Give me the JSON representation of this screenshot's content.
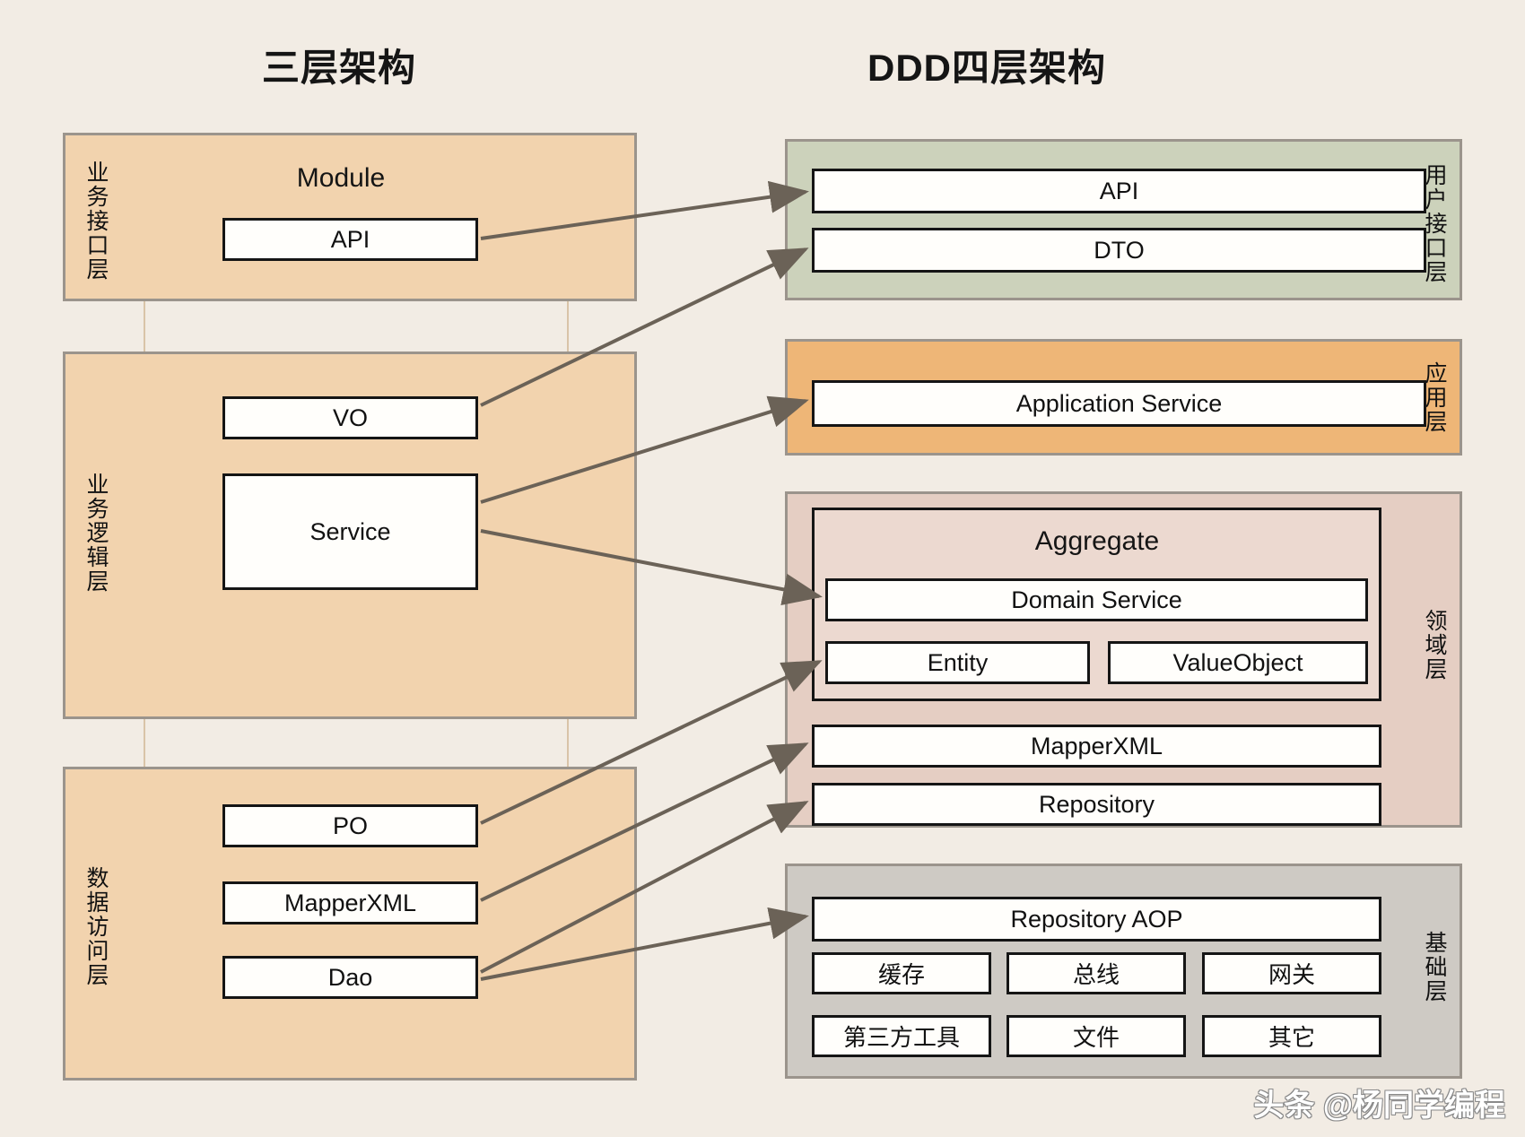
{
  "titles": {
    "left": "三层架构",
    "right": "DDD四层架构"
  },
  "colors": {
    "canvas": "#f2ece4",
    "tan": "#f2d3ae",
    "green": "#ccd2bb",
    "orange": "#eeb677",
    "pink": "#e5cec3",
    "aggregate": "#ecd9d0",
    "grey": "#cecac4",
    "group_border": "#9b948c",
    "box_border": "#151515",
    "box_fill": "#fffefb",
    "arrow": "#6b6257"
  },
  "left_column": {
    "layers": [
      {
        "side_label": "业务接口层",
        "boxes": [
          "API"
        ]
      },
      {
        "side_label": "业务逻辑层",
        "boxes": [
          "VO",
          "Service"
        ]
      },
      {
        "side_label": "数据访问层",
        "boxes": [
          "PO",
          "MapperXML",
          "Dao"
        ]
      }
    ],
    "module_label": "Module"
  },
  "right_column": {
    "layers": [
      {
        "side_label": "用户接口层",
        "boxes": [
          "API",
          "DTO"
        ]
      },
      {
        "side_label": "应用层",
        "boxes": [
          "Application Service"
        ]
      },
      {
        "side_label": "领域层",
        "aggregate_label": "Aggregate",
        "aggregate_boxes": [
          "Domain Service",
          "Entity",
          "ValueObject"
        ],
        "boxes": [
          "MapperXML",
          "Repository"
        ]
      },
      {
        "side_label": "基础层",
        "boxes": [
          "Repository AOP"
        ],
        "grid_boxes": [
          "缓存",
          "总线",
          "网关",
          "第三方工具",
          "文件",
          "其它"
        ]
      }
    ]
  },
  "watermark": "头条 @杨同学编程"
}
